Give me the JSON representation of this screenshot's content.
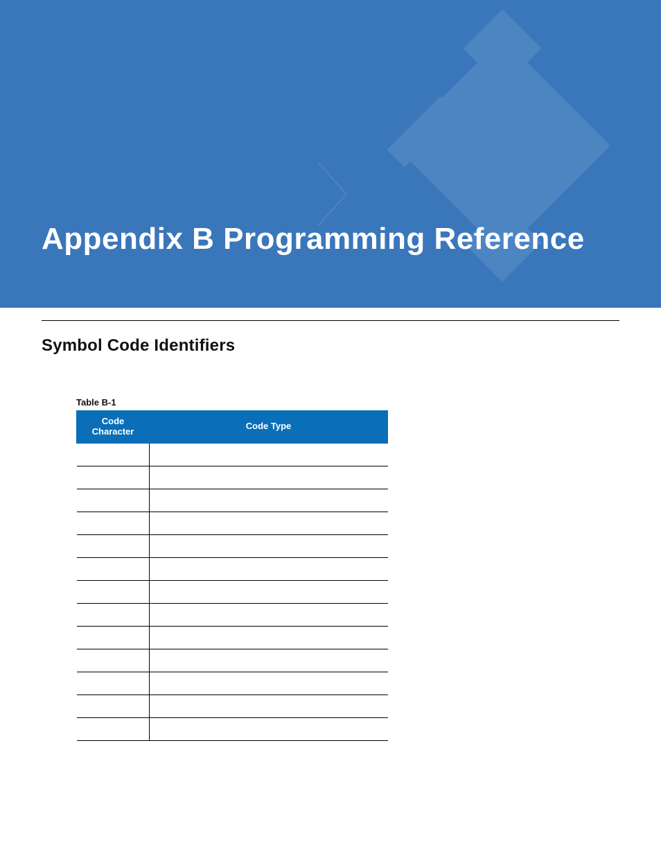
{
  "banner": {
    "title": "Appendix B  Programming Reference"
  },
  "section": {
    "title": "Symbol Code Identifiers"
  },
  "table": {
    "label": "Table B-1",
    "headers": {
      "col1": "Code\nCharacter",
      "col2": "Code Type"
    },
    "rows": [
      {
        "code": "",
        "type": ""
      },
      {
        "code": "",
        "type": ""
      },
      {
        "code": "",
        "type": ""
      },
      {
        "code": "",
        "type": ""
      },
      {
        "code": "",
        "type": ""
      },
      {
        "code": "",
        "type": ""
      },
      {
        "code": "",
        "type": ""
      },
      {
        "code": "",
        "type": ""
      },
      {
        "code": "",
        "type": ""
      },
      {
        "code": "",
        "type": ""
      },
      {
        "code": "",
        "type": ""
      },
      {
        "code": "",
        "type": ""
      },
      {
        "code": "",
        "type": ""
      }
    ]
  },
  "colors": {
    "brand": "#3a76ba",
    "tableHeader": "#0a6fb8"
  }
}
